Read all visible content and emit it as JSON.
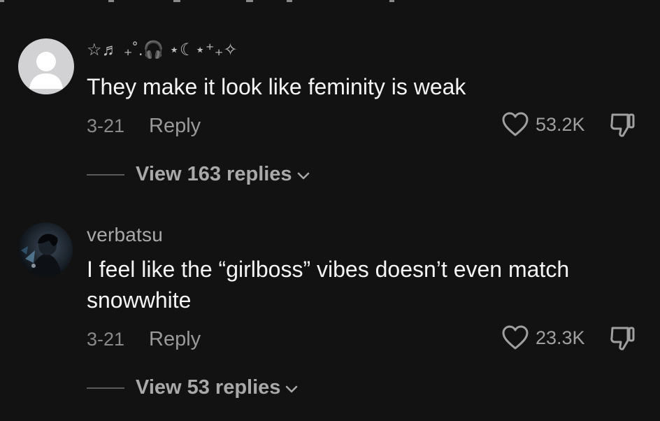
{
  "comments": [
    {
      "username": "☆♬ ₊˚.🎧 ⋆☾⋆⁺₊✧",
      "text": "They make it look like feminity is weak",
      "date": "3-21",
      "reply_label": "Reply",
      "likes": "53.2K",
      "replies_label": "View 163 replies"
    },
    {
      "username": "verbatsu",
      "text": "I feel like the “girlboss” vibes doesn’t even match snowwhite",
      "date": "3-21",
      "reply_label": "Reply",
      "likes": "23.3K",
      "replies_label": "View 53 replies"
    }
  ]
}
